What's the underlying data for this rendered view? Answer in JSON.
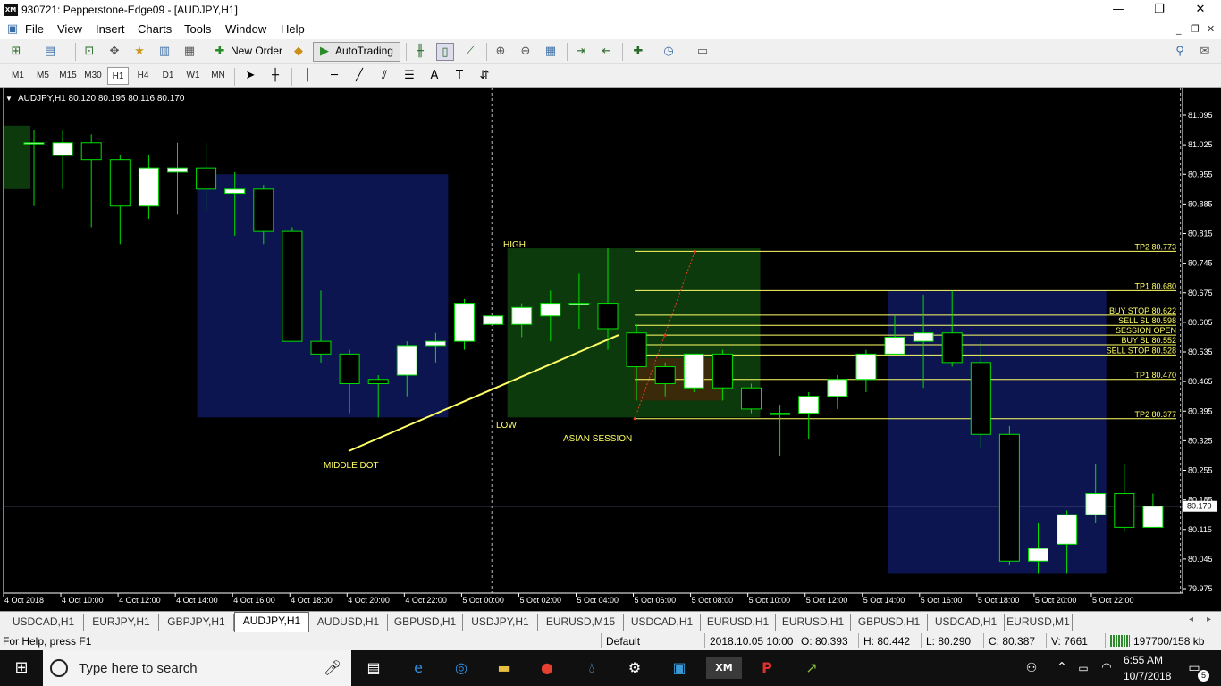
{
  "window": {
    "title": "930721: Pepperstone-Edge09 - [AUDJPY,H1]",
    "logo": "XM",
    "minimize": "—",
    "maximize": "❐",
    "close": "✕"
  },
  "menu": [
    "File",
    "View",
    "Insert",
    "Charts",
    "Tools",
    "Window",
    "Help"
  ],
  "toolbar": {
    "new_order": "New Order",
    "autotrading": "AutoTrading"
  },
  "timeframes": [
    "M1",
    "M5",
    "M15",
    "M30",
    "H1",
    "H4",
    "D1",
    "W1",
    "MN"
  ],
  "active_timeframe": "H1",
  "chart": {
    "header": "AUDJPY,H1  80.120 80.195 80.116 80.170",
    "current_price_label": "80.170",
    "price_ticks": [
      "81.095",
      "81.025",
      "80.955",
      "80.885",
      "80.815",
      "80.745",
      "80.675",
      "80.605",
      "80.535",
      "80.465",
      "80.395",
      "80.325",
      "80.255",
      "80.185",
      "80.115",
      "80.045",
      "79.975"
    ],
    "time_ticks": [
      "4 Oct 2018",
      "4 Oct 10:00",
      "4 Oct 12:00",
      "4 Oct 14:00",
      "4 Oct 16:00",
      "4 Oct 18:00",
      "4 Oct 20:00",
      "4 Oct 22:00",
      "5 Oct 00:00",
      "5 Oct 02:00",
      "5 Oct 04:00",
      "5 Oct 06:00",
      "5 Oct 08:00",
      "5 Oct 10:00",
      "5 Oct 12:00",
      "5 Oct 14:00",
      "5 Oct 16:00",
      "5 Oct 18:00",
      "5 Oct 20:00",
      "5 Oct 22:00"
    ],
    "levels": [
      {
        "label": "TP2 80.773",
        "price": 80.773
      },
      {
        "label": "TP1 80.680",
        "price": 80.68
      },
      {
        "label": "BUY STOP 80.622",
        "price": 80.622
      },
      {
        "label": "SELL SL 80.598",
        "price": 80.598
      },
      {
        "label": "SESSION OPEN",
        "price": 80.575
      },
      {
        "label": "BUY SL 80.552",
        "price": 80.552
      },
      {
        "label": "SELL STOP 80.528",
        "price": 80.528
      },
      {
        "label": "TP1 80.470",
        "price": 80.47
      },
      {
        "label": "TP2 80.377",
        "price": 80.377
      }
    ],
    "annotations": {
      "high": "HIGH",
      "low": "LOW",
      "asian_session": "ASIAN SESSION",
      "middle_dot": "MIDDLE DOT"
    },
    "candles": [
      {
        "o": 81.03,
        "h": 81.06,
        "l": 80.88,
        "c": 81.03
      },
      {
        "o": 81.0,
        "h": 81.06,
        "l": 80.92,
        "c": 81.03
      },
      {
        "o": 81.03,
        "h": 81.05,
        "l": 80.83,
        "c": 80.99
      },
      {
        "o": 80.99,
        "h": 81.0,
        "l": 80.79,
        "c": 80.88
      },
      {
        "o": 80.88,
        "h": 81.0,
        "l": 80.85,
        "c": 80.97
      },
      {
        "o": 80.96,
        "h": 81.03,
        "l": 80.86,
        "c": 80.97
      },
      {
        "o": 80.97,
        "h": 81.03,
        "l": 80.87,
        "c": 80.92
      },
      {
        "o": 80.91,
        "h": 80.96,
        "l": 80.81,
        "c": 80.92
      },
      {
        "o": 80.92,
        "h": 80.93,
        "l": 80.79,
        "c": 80.82
      },
      {
        "o": 80.82,
        "h": 80.83,
        "l": 80.56,
        "c": 80.56
      },
      {
        "o": 80.56,
        "h": 80.68,
        "l": 80.51,
        "c": 80.53
      },
      {
        "o": 80.53,
        "h": 80.54,
        "l": 80.39,
        "c": 80.46
      },
      {
        "o": 80.47,
        "h": 80.48,
        "l": 80.38,
        "c": 80.46
      },
      {
        "o": 80.48,
        "h": 80.56,
        "l": 80.43,
        "c": 80.55
      },
      {
        "o": 80.55,
        "h": 80.58,
        "l": 80.51,
        "c": 80.56
      },
      {
        "o": 80.56,
        "h": 80.66,
        "l": 80.54,
        "c": 80.65
      },
      {
        "o": 80.6,
        "h": 80.62,
        "l": 80.56,
        "c": 80.62
      },
      {
        "o": 80.6,
        "h": 80.65,
        "l": 80.57,
        "c": 80.64
      },
      {
        "o": 80.62,
        "h": 80.68,
        "l": 80.56,
        "c": 80.65
      },
      {
        "o": 80.65,
        "h": 80.72,
        "l": 80.59,
        "c": 80.65
      },
      {
        "o": 80.65,
        "h": 80.78,
        "l": 80.54,
        "c": 80.59
      },
      {
        "o": 80.58,
        "h": 80.6,
        "l": 80.42,
        "c": 80.5
      },
      {
        "o": 80.5,
        "h": 80.51,
        "l": 80.43,
        "c": 80.46
      },
      {
        "o": 80.45,
        "h": 80.53,
        "l": 80.44,
        "c": 80.53
      },
      {
        "o": 80.53,
        "h": 80.54,
        "l": 80.42,
        "c": 80.45
      },
      {
        "o": 80.45,
        "h": 80.46,
        "l": 80.39,
        "c": 80.4
      },
      {
        "o": 80.39,
        "h": 80.41,
        "l": 80.29,
        "c": 80.39
      },
      {
        "o": 80.39,
        "h": 80.44,
        "l": 80.33,
        "c": 80.43
      },
      {
        "o": 80.43,
        "h": 80.48,
        "l": 80.4,
        "c": 80.47
      },
      {
        "o": 80.47,
        "h": 80.54,
        "l": 80.44,
        "c": 80.53
      },
      {
        "o": 80.53,
        "h": 80.62,
        "l": 80.53,
        "c": 80.57
      },
      {
        "o": 80.56,
        "h": 80.67,
        "l": 80.45,
        "c": 80.58
      },
      {
        "o": 80.58,
        "h": 80.68,
        "l": 80.5,
        "c": 80.51
      },
      {
        "o": 80.51,
        "h": 80.56,
        "l": 80.31,
        "c": 80.34
      },
      {
        "o": 80.34,
        "h": 80.36,
        "l": 80.03,
        "c": 80.04
      },
      {
        "o": 80.04,
        "h": 80.13,
        "l": 80.01,
        "c": 80.07
      },
      {
        "o": 80.08,
        "h": 80.16,
        "l": 80.01,
        "c": 80.15
      },
      {
        "o": 80.15,
        "h": 80.27,
        "l": 80.13,
        "c": 80.2
      },
      {
        "o": 80.2,
        "h": 80.27,
        "l": 80.11,
        "c": 80.12
      },
      {
        "o": 80.12,
        "h": 80.2,
        "l": 80.12,
        "c": 80.17
      }
    ]
  },
  "tabs": [
    "USDCAD,H1",
    "EURJPY,H1",
    "GBPJPY,H1",
    "AUDJPY,H1",
    "AUDUSD,H1",
    "GBPUSD,H1",
    "USDJPY,H1",
    "EURUSD,M15",
    "USDCAD,H1",
    "EURUSD,H1",
    "EURUSD,H1",
    "GBPUSD,H1",
    "USDCAD,H1",
    "EURUSD,M1"
  ],
  "active_tab": "AUDJPY,H1",
  "status": {
    "help": "For Help, press F1",
    "profile": "Default",
    "datetime": "2018.10.05 10:00",
    "open": "O: 80.393",
    "high": "H: 80.442",
    "low": "L: 80.290",
    "close": "C: 80.387",
    "volume": "V: 7661",
    "traffic": "197700/158 kb"
  },
  "taskbar": {
    "search_placeholder": "Type here to search",
    "time": "6:55 AM",
    "date": "10/7/2018",
    "notifications": "5"
  },
  "colors": {
    "chart_bg": "#000000",
    "bull_candle": "#ffffff",
    "wick": "#00e000",
    "level_line": "#ffff66",
    "asian_box": "#0c3a0c",
    "blue_box": "#0c154f"
  }
}
